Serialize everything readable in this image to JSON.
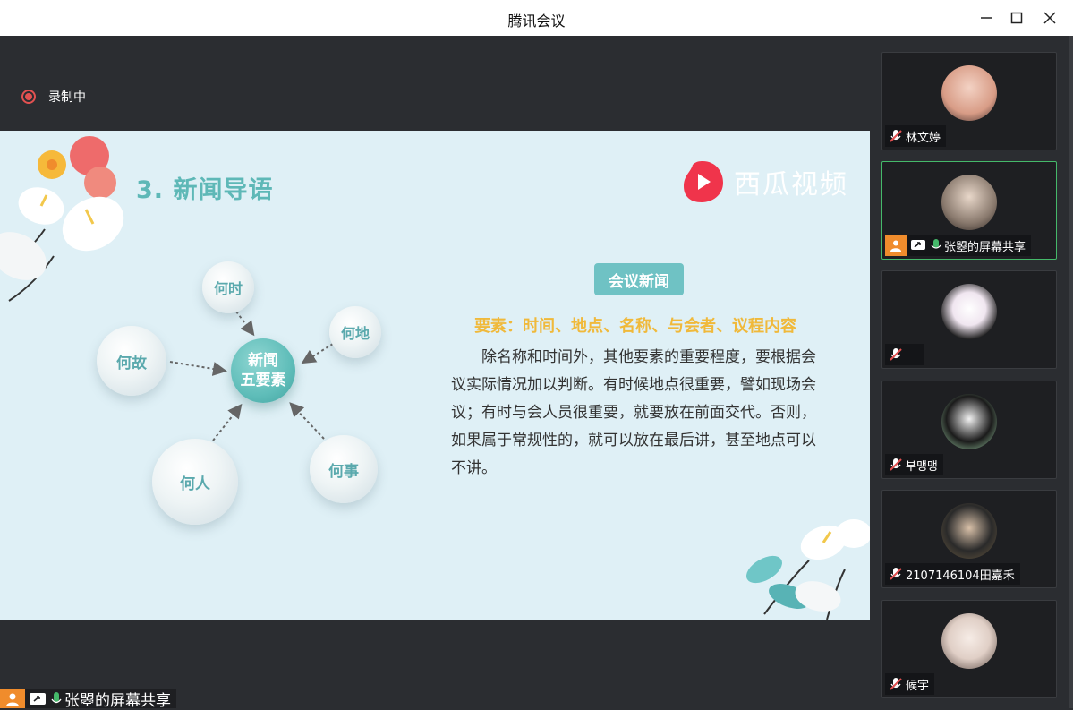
{
  "window": {
    "title": "腾讯会议"
  },
  "recording": {
    "label": "录制中"
  },
  "slide": {
    "title": "3. 新闻导语",
    "brand": "西瓜视频",
    "center": [
      "新闻",
      "五要素"
    ],
    "bubbles": [
      "何时",
      "何地",
      "何故",
      "何人",
      "何事"
    ],
    "tag": "会议新闻",
    "subtitle": "要素：时间、地点、名称、与会者、议程内容",
    "paragraph": "除名称和时间外，其他要素的重要程度，要根据会议实际情况加以判断。有时候地点很重要，譬如现场会议；有时与会人员很重要，就要放在前面交代。否则，如果属于常规性的，就可以放在最后讲，甚至地点可以不讲。"
  },
  "participants": [
    {
      "name": "林文婷",
      "muted": true
    },
    {
      "name": "张曌的屏幕共享",
      "muted": false,
      "sharing": true
    },
    {
      "name": "",
      "muted": true
    },
    {
      "name": "부맹맹",
      "muted": true
    },
    {
      "name": "2107146104田嘉禾",
      "muted": true
    },
    {
      "name": "候宇",
      "muted": true
    }
  ],
  "share_bar": {
    "label": "张曌的屏幕共享"
  },
  "colors": {
    "accent": "#5eb8b7",
    "active_border": "#45b96a",
    "record": "#e35151",
    "share_orange": "#f08c2c"
  }
}
